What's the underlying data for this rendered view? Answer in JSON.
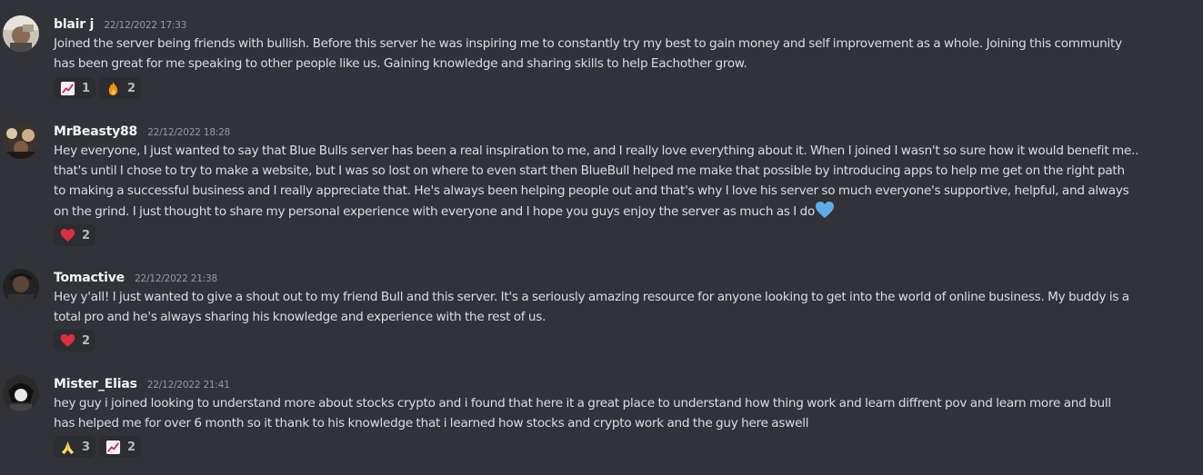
{
  "messages": [
    {
      "username": "blair j",
      "timestamp": "22/12/2022 17:33",
      "lines": [
        "Joined the server being friends with bullish. Before this server he was inspiring me to constantly try my best to gain money and self improvement as a whole. Joining this community",
        "has been great for me speaking to other people like us. Gaining knowledge and sharing skills to help Eachother grow."
      ],
      "reactions": [
        {
          "emoji": "chart-increasing-emoji",
          "count": "1"
        },
        {
          "emoji": "fire-emoji",
          "count": "2"
        }
      ]
    },
    {
      "username": "MrBeasty88",
      "timestamp": "22/12/2022 18:28",
      "lines": [
        "Hey everyone, I just wanted to say that Blue Bulls server has been a real inspiration to me, and I really love everything about it. When I joined I wasn't so sure how it would benefit me..",
        "that's until I chose to try to make a website, but I was so lost on where to even start then BlueBull helped me make that possible by introducing apps to help me get on the right path",
        "to making a successful business and I really appreciate that. He's always been helping people out and that's why I love his server so much everyone's supportive, helpful, and always",
        "on the grind. I just thought to share my personal experience with everyone and I hope you guys enjoy the server as much as I do"
      ],
      "inline_emoji": "blue-heart-emoji",
      "reactions": [
        {
          "emoji": "red-heart-emoji",
          "count": "2"
        }
      ]
    },
    {
      "username": "Tomactive",
      "timestamp": "22/12/2022 21:38",
      "lines": [
        "Hey y'all! I just wanted to give a shout out to my friend Bull and this server. It's a seriously amazing resource for anyone looking to get into the world of online business. My buddy is a",
        "total pro and he's always sharing his knowledge and experience with the rest of us."
      ],
      "reactions": [
        {
          "emoji": "red-heart-emoji",
          "count": "2"
        }
      ]
    },
    {
      "username": "Mister_Elias",
      "timestamp": "22/12/2022 21:41",
      "lines": [
        "hey guy i joined looking to understand more about stocks crypto and i found that here it  a great place to understand how thing work and learn diffrent pov and learn more and bull",
        "has helped me for over 6 month so it thank to his knowledge that i learned how stocks and crypto work and the guy here aswell"
      ],
      "reactions": [
        {
          "emoji": "folded-hands-emoji",
          "count": "3"
        },
        {
          "emoji": "chart-increasing-emoji",
          "count": "2"
        }
      ]
    }
  ],
  "colors": {
    "background": "#313338",
    "reaction_bg": "#2b2d31",
    "username": "#f2f3f5",
    "text": "#dbdee1",
    "timestamp": "#949ba4"
  }
}
